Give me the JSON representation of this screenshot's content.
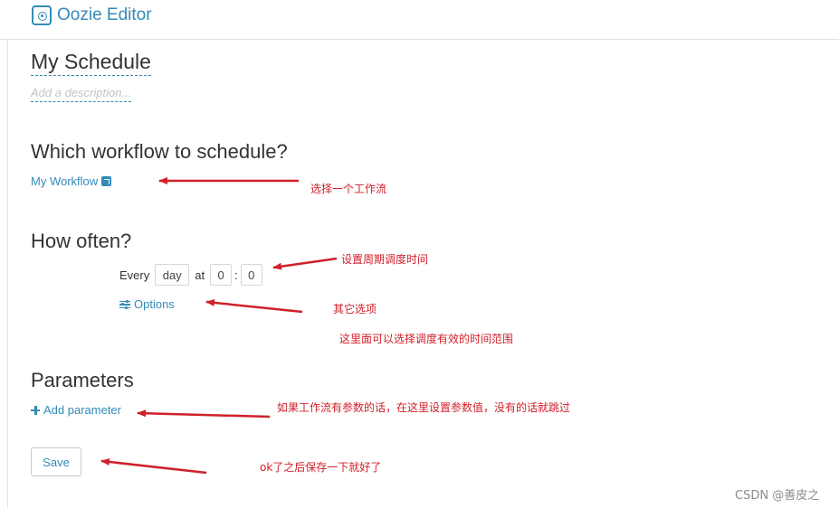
{
  "header": {
    "app_title": "Oozie Editor"
  },
  "schedule": {
    "name": "My Schedule",
    "description_placeholder": "Add a description..."
  },
  "sections": {
    "workflow_title": "Which workflow to schedule?",
    "often_title": "How often?",
    "params_title": "Parameters"
  },
  "workflow": {
    "link_label": "My Workflow",
    "icon": "external-link-icon"
  },
  "frequency": {
    "every_label": "Every",
    "unit": "day",
    "at_label": "at",
    "hour": "0",
    "separator": ":",
    "minute": "0"
  },
  "options": {
    "label": "Options",
    "icon": "sliders-icon"
  },
  "parameters": {
    "add_label": "Add parameter",
    "icon": "plus-icon"
  },
  "actions": {
    "save_label": "Save"
  },
  "annotations": {
    "workflow": "选择一个工作流",
    "schedule_time": "设置周期调度时间",
    "other_options": "其它选项",
    "time_range": "这里面可以选择调度有效的时间范围",
    "params": "如果工作流有参数的话，在这里设置参数值，没有的话就跳过",
    "save": "ok了之后保存一下就好了"
  },
  "watermark": "CSDN @善皮之",
  "colors": {
    "accent": "#338bb8",
    "annotation_red": "#d0202a"
  }
}
